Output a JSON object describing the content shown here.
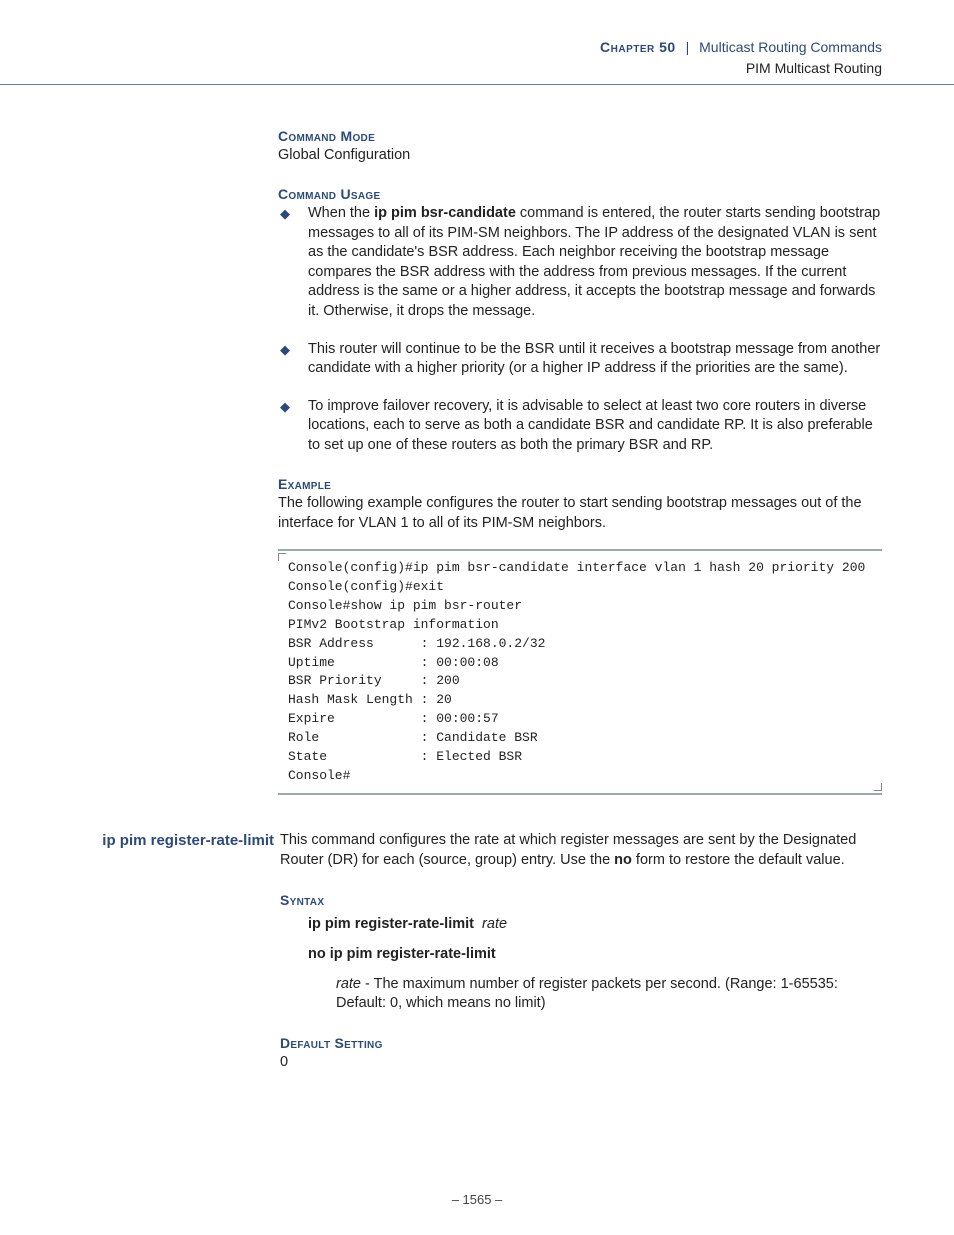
{
  "header": {
    "chapter_label": "Chapter 50",
    "separator": "|",
    "subject": "Multicast Routing Commands",
    "sub": "PIM Multicast Routing"
  },
  "sec1": {
    "mode_hdr": "Command Mode",
    "mode_text": "Global Configuration",
    "usage_hdr": "Command Usage",
    "bullets": {
      "b1_pre": "When the ",
      "b1_cmd": "ip pim bsr-candidate",
      "b1_post": " command is entered, the router starts sending bootstrap messages to all of its PIM-SM neighbors. The IP address of the designated VLAN is sent as the candidate's BSR address. Each neighbor receiving the bootstrap message compares the BSR address with the address from previous messages. If the current address is the same or a higher address, it accepts the bootstrap message and forwards it. Otherwise, it drops the message.",
      "b2": "This router will continue to be the BSR until it receives a bootstrap message from another candidate with a higher priority (or a higher IP address if the priorities are the same).",
      "b3": "To improve failover recovery, it is advisable to select at least two core routers in diverse locations, each to serve as both a candidate BSR and candidate RP. It is also preferable to set up one of these routers as both the primary BSR and RP."
    },
    "example_hdr": "Example",
    "example_intro": "The following example configures the router to start sending bootstrap messages out of the interface for VLAN 1 to all of its PIM-SM neighbors.",
    "code": "Console(config)#ip pim bsr-candidate interface vlan 1 hash 20 priority 200\nConsole(config)#exit\nConsole#show ip pim bsr-router\nPIMv2 Bootstrap information\nBSR Address      : 192.168.0.2/32\nUptime           : 00:00:08\nBSR Priority     : 200\nHash Mask Length : 20\nExpire           : 00:00:57\nRole             : Candidate BSR\nState            : Elected BSR\nConsole#"
  },
  "sec2": {
    "cmd_name": "ip pim register-rate-limit",
    "desc_pre": "This command configures the rate at which register messages are sent by the Designated Router (DR) for each (source, group) entry. Use the ",
    "desc_bold": "no",
    "desc_post": " form to restore the default value.",
    "syntax_hdr": "Syntax",
    "syntax1_cmd": "ip pim register-rate-limit",
    "syntax1_arg": "rate",
    "syntax2": "no ip pim register-rate-limit",
    "arg_name": "rate",
    "arg_desc": " - The maximum number of register packets per second. (Range: 1-65535: Default: 0, which means no limit)",
    "default_hdr": "Default Setting",
    "default_val": "0"
  },
  "footer": {
    "page": "–  1565  –"
  }
}
